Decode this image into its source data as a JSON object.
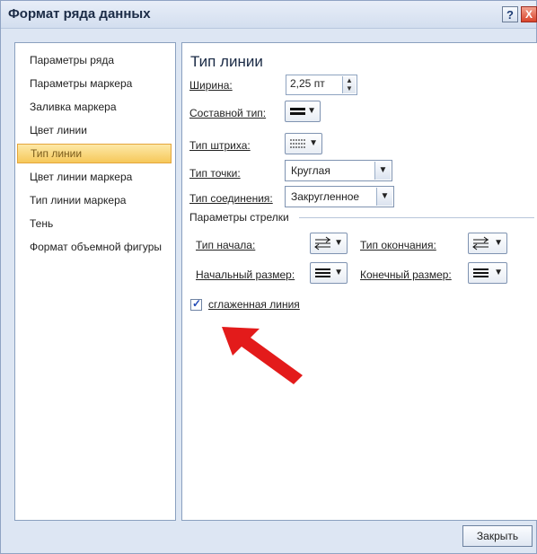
{
  "window": {
    "title": "Формат ряда данных",
    "help_label": "?",
    "close_label": "X"
  },
  "sidebar": {
    "items": [
      {
        "label": "Параметры ряда"
      },
      {
        "label": "Параметры маркера"
      },
      {
        "label": "Заливка маркера"
      },
      {
        "label": "Цвет линии"
      },
      {
        "label": "Тип линии",
        "selected": true
      },
      {
        "label": "Цвет линии маркера"
      },
      {
        "label": "Тип линии маркера"
      },
      {
        "label": "Тень"
      },
      {
        "label": "Формат объемной фигуры"
      }
    ]
  },
  "panel": {
    "title": "Тип линии",
    "width_label": "Ширина:",
    "width_value": "2,25 пт",
    "compound_label": "Составной тип:",
    "dash_label": "Тип штриха:",
    "cap_label": "Тип точки:",
    "cap_value": "Круглая",
    "join_label": "Тип соединения:",
    "join_value": "Закругленное",
    "arrow_section": "Параметры стрелки",
    "begin_type_label": "Тип начала:",
    "end_type_label": "Тип окончания:",
    "begin_size_label": "Начальный размер:",
    "end_size_label": "Конечный размер:",
    "smooth_label": "сглаженная линия",
    "smooth_checked": true
  },
  "footer": {
    "close_button": "Закрыть"
  },
  "colors": {
    "annotation_arrow": "#e31b1b",
    "selection": "#f6c85a"
  },
  "icons": {
    "compound": "lines-icon",
    "dash": "dash-icon",
    "arrow_type": "arrow-type-icon",
    "arrow_size": "arrow-size-icon"
  }
}
